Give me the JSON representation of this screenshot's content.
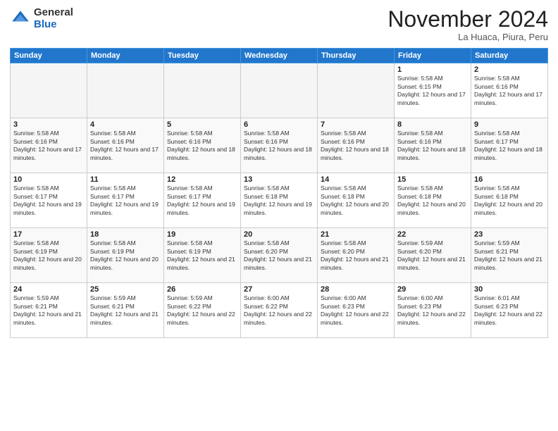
{
  "header": {
    "logo_general": "General",
    "logo_blue": "Blue",
    "month_title": "November 2024",
    "location": "La Huaca, Piura, Peru"
  },
  "days_of_week": [
    "Sunday",
    "Monday",
    "Tuesday",
    "Wednesday",
    "Thursday",
    "Friday",
    "Saturday"
  ],
  "weeks": [
    [
      {
        "day": "",
        "info": ""
      },
      {
        "day": "",
        "info": ""
      },
      {
        "day": "",
        "info": ""
      },
      {
        "day": "",
        "info": ""
      },
      {
        "day": "",
        "info": ""
      },
      {
        "day": "1",
        "info": "Sunrise: 5:58 AM\nSunset: 6:15 PM\nDaylight: 12 hours and 17 minutes."
      },
      {
        "day": "2",
        "info": "Sunrise: 5:58 AM\nSunset: 6:16 PM\nDaylight: 12 hours and 17 minutes."
      }
    ],
    [
      {
        "day": "3",
        "info": "Sunrise: 5:58 AM\nSunset: 6:16 PM\nDaylight: 12 hours and 17 minutes."
      },
      {
        "day": "4",
        "info": "Sunrise: 5:58 AM\nSunset: 6:16 PM\nDaylight: 12 hours and 17 minutes."
      },
      {
        "day": "5",
        "info": "Sunrise: 5:58 AM\nSunset: 6:16 PM\nDaylight: 12 hours and 18 minutes."
      },
      {
        "day": "6",
        "info": "Sunrise: 5:58 AM\nSunset: 6:16 PM\nDaylight: 12 hours and 18 minutes."
      },
      {
        "day": "7",
        "info": "Sunrise: 5:58 AM\nSunset: 6:16 PM\nDaylight: 12 hours and 18 minutes."
      },
      {
        "day": "8",
        "info": "Sunrise: 5:58 AM\nSunset: 6:16 PM\nDaylight: 12 hours and 18 minutes."
      },
      {
        "day": "9",
        "info": "Sunrise: 5:58 AM\nSunset: 6:17 PM\nDaylight: 12 hours and 18 minutes."
      }
    ],
    [
      {
        "day": "10",
        "info": "Sunrise: 5:58 AM\nSunset: 6:17 PM\nDaylight: 12 hours and 19 minutes."
      },
      {
        "day": "11",
        "info": "Sunrise: 5:58 AM\nSunset: 6:17 PM\nDaylight: 12 hours and 19 minutes."
      },
      {
        "day": "12",
        "info": "Sunrise: 5:58 AM\nSunset: 6:17 PM\nDaylight: 12 hours and 19 minutes."
      },
      {
        "day": "13",
        "info": "Sunrise: 5:58 AM\nSunset: 6:18 PM\nDaylight: 12 hours and 19 minutes."
      },
      {
        "day": "14",
        "info": "Sunrise: 5:58 AM\nSunset: 6:18 PM\nDaylight: 12 hours and 20 minutes."
      },
      {
        "day": "15",
        "info": "Sunrise: 5:58 AM\nSunset: 6:18 PM\nDaylight: 12 hours and 20 minutes."
      },
      {
        "day": "16",
        "info": "Sunrise: 5:58 AM\nSunset: 6:18 PM\nDaylight: 12 hours and 20 minutes."
      }
    ],
    [
      {
        "day": "17",
        "info": "Sunrise: 5:58 AM\nSunset: 6:19 PM\nDaylight: 12 hours and 20 minutes."
      },
      {
        "day": "18",
        "info": "Sunrise: 5:58 AM\nSunset: 6:19 PM\nDaylight: 12 hours and 20 minutes."
      },
      {
        "day": "19",
        "info": "Sunrise: 5:58 AM\nSunset: 6:19 PM\nDaylight: 12 hours and 21 minutes."
      },
      {
        "day": "20",
        "info": "Sunrise: 5:58 AM\nSunset: 6:20 PM\nDaylight: 12 hours and 21 minutes."
      },
      {
        "day": "21",
        "info": "Sunrise: 5:58 AM\nSunset: 6:20 PM\nDaylight: 12 hours and 21 minutes."
      },
      {
        "day": "22",
        "info": "Sunrise: 5:59 AM\nSunset: 6:20 PM\nDaylight: 12 hours and 21 minutes."
      },
      {
        "day": "23",
        "info": "Sunrise: 5:59 AM\nSunset: 6:21 PM\nDaylight: 12 hours and 21 minutes."
      }
    ],
    [
      {
        "day": "24",
        "info": "Sunrise: 5:59 AM\nSunset: 6:21 PM\nDaylight: 12 hours and 21 minutes."
      },
      {
        "day": "25",
        "info": "Sunrise: 5:59 AM\nSunset: 6:21 PM\nDaylight: 12 hours and 21 minutes."
      },
      {
        "day": "26",
        "info": "Sunrise: 5:59 AM\nSunset: 6:22 PM\nDaylight: 12 hours and 22 minutes."
      },
      {
        "day": "27",
        "info": "Sunrise: 6:00 AM\nSunset: 6:22 PM\nDaylight: 12 hours and 22 minutes."
      },
      {
        "day": "28",
        "info": "Sunrise: 6:00 AM\nSunset: 6:23 PM\nDaylight: 12 hours and 22 minutes."
      },
      {
        "day": "29",
        "info": "Sunrise: 6:00 AM\nSunset: 6:23 PM\nDaylight: 12 hours and 22 minutes."
      },
      {
        "day": "30",
        "info": "Sunrise: 6:01 AM\nSunset: 6:23 PM\nDaylight: 12 hours and 22 minutes."
      }
    ]
  ]
}
